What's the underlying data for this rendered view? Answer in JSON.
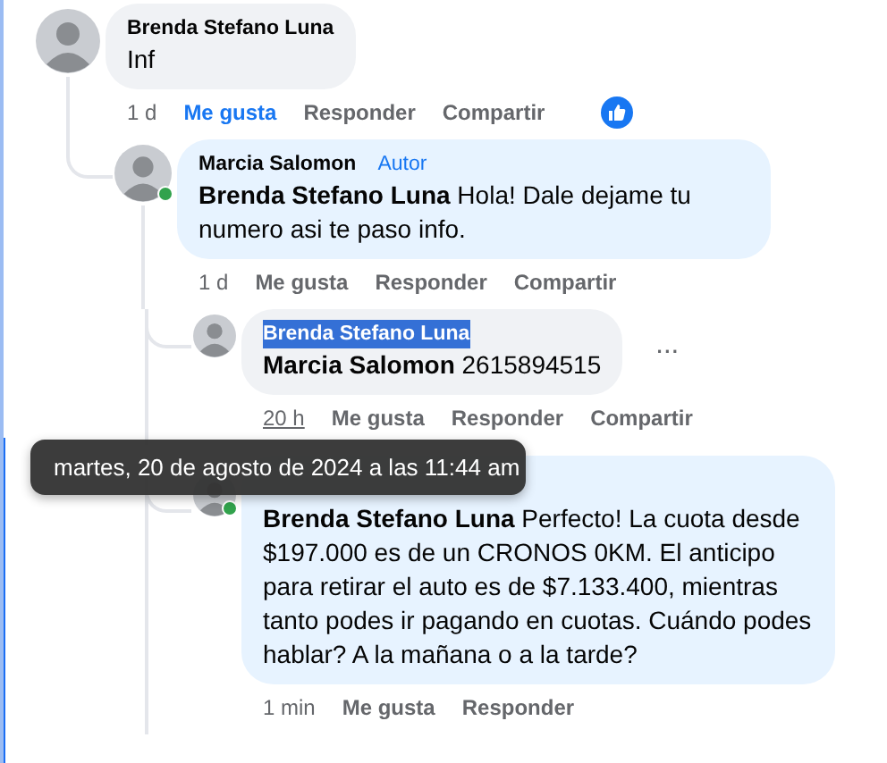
{
  "comments": [
    {
      "author": "Brenda Stefano Luna",
      "text": "Inf",
      "time": "1 d",
      "liked": true,
      "actions": [
        "Me gusta",
        "Responder",
        "Compartir"
      ],
      "reaction": {
        "kind": "like"
      },
      "thread_continues": false,
      "children": [
        {
          "author": "Marcia Salomon",
          "badge": "Autor",
          "online": true,
          "text": "**Brenda Stefano Luna** Hola! Dale dejame tu numero asi te paso info.",
          "time": "1 d",
          "liked": false,
          "actions": [
            "Me gusta",
            "Responder",
            "Compartir"
          ],
          "thread_continues": true,
          "children": [
            {
              "author": "Brenda Stefano Luna",
              "author_selected": true,
              "text": "**Marcia Salomon** 2615894515",
              "time": "20 h",
              "time_hovered": true,
              "liked": false,
              "actions": [
                "Me gusta",
                "Responder",
                "Compartir"
              ],
              "more_menu": "···"
            },
            {
              "online": true,
              "text": "**Brenda Stefano Luna** Perfecto! La cuota desde $197.000 es de un CRONOS 0KM. El anticipo para retirar el auto es de $7.133.400, mientras tanto podes ir pagando en cuotas. Cuándo podes hablar? A la mañana o a la tarde?",
              "time": "1 min",
              "liked": false,
              "actions": [
                "Me gusta",
                "Responder"
              ]
            }
          ]
        }
      ]
    }
  ],
  "tooltip": "martes, 20 de agosto de 2024 a las 11:44 am"
}
